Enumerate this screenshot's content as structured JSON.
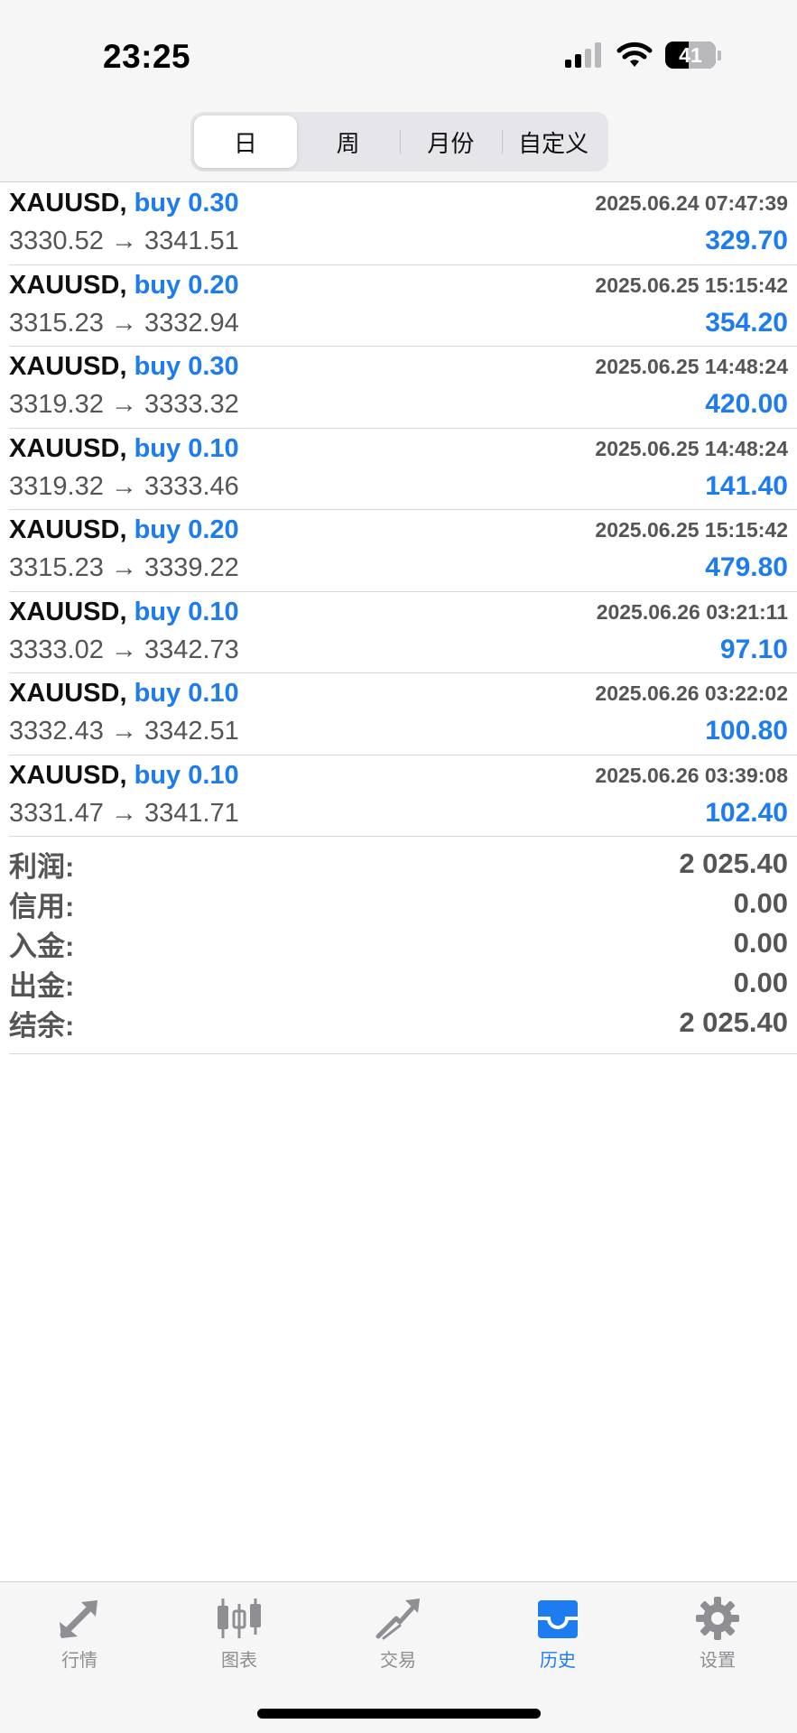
{
  "status": {
    "time": "23:25",
    "battery": "41"
  },
  "segments": [
    {
      "label": "日",
      "active": true
    },
    {
      "label": "周",
      "active": false
    },
    {
      "label": "月份",
      "active": false
    },
    {
      "label": "自定义",
      "active": false
    }
  ],
  "trades": [
    {
      "symbol": "XAUUSD,",
      "side": "buy 0.30",
      "datetime": "2025.06.24 07:47:39",
      "prices": "3330.52 → 3341.51",
      "profit": "329.70"
    },
    {
      "symbol": "XAUUSD,",
      "side": "buy 0.20",
      "datetime": "2025.06.25 15:15:42",
      "prices": "3315.23 → 3332.94",
      "profit": "354.20"
    },
    {
      "symbol": "XAUUSD,",
      "side": "buy 0.30",
      "datetime": "2025.06.25 14:48:24",
      "prices": "3319.32 → 3333.32",
      "profit": "420.00"
    },
    {
      "symbol": "XAUUSD,",
      "side": "buy 0.10",
      "datetime": "2025.06.25 14:48:24",
      "prices": "3319.32 → 3333.46",
      "profit": "141.40"
    },
    {
      "symbol": "XAUUSD,",
      "side": "buy 0.20",
      "datetime": "2025.06.25 15:15:42",
      "prices": "3315.23 → 3339.22",
      "profit": "479.80"
    },
    {
      "symbol": "XAUUSD,",
      "side": "buy 0.10",
      "datetime": "2025.06.26 03:21:11",
      "prices": "3333.02 → 3342.73",
      "profit": "97.10"
    },
    {
      "symbol": "XAUUSD,",
      "side": "buy 0.10",
      "datetime": "2025.06.26 03:22:02",
      "prices": "3332.43 → 3342.51",
      "profit": "100.80"
    },
    {
      "symbol": "XAUUSD,",
      "side": "buy 0.10",
      "datetime": "2025.06.26 03:39:08",
      "prices": "3331.47 → 3341.71",
      "profit": "102.40"
    }
  ],
  "summary": [
    {
      "label": "利润:",
      "value": "2 025.40"
    },
    {
      "label": "信用:",
      "value": "0.00"
    },
    {
      "label": "入金:",
      "value": "0.00"
    },
    {
      "label": "出金:",
      "value": "0.00"
    },
    {
      "label": "结余:",
      "value": "2 025.40"
    }
  ],
  "tabs": [
    {
      "label": "行情",
      "icon": "quotes-arrows-icon",
      "active": false
    },
    {
      "label": "图表",
      "icon": "candlestick-chart-icon",
      "active": false
    },
    {
      "label": "交易",
      "icon": "trade-trend-icon",
      "active": false
    },
    {
      "label": "历史",
      "icon": "history-inbox-icon",
      "active": true
    },
    {
      "label": "设置",
      "icon": "gear-icon",
      "active": false
    }
  ],
  "colors": {
    "accent": "#1c7cf0",
    "muted": "#8e8e93",
    "text_gray": "#555555"
  }
}
